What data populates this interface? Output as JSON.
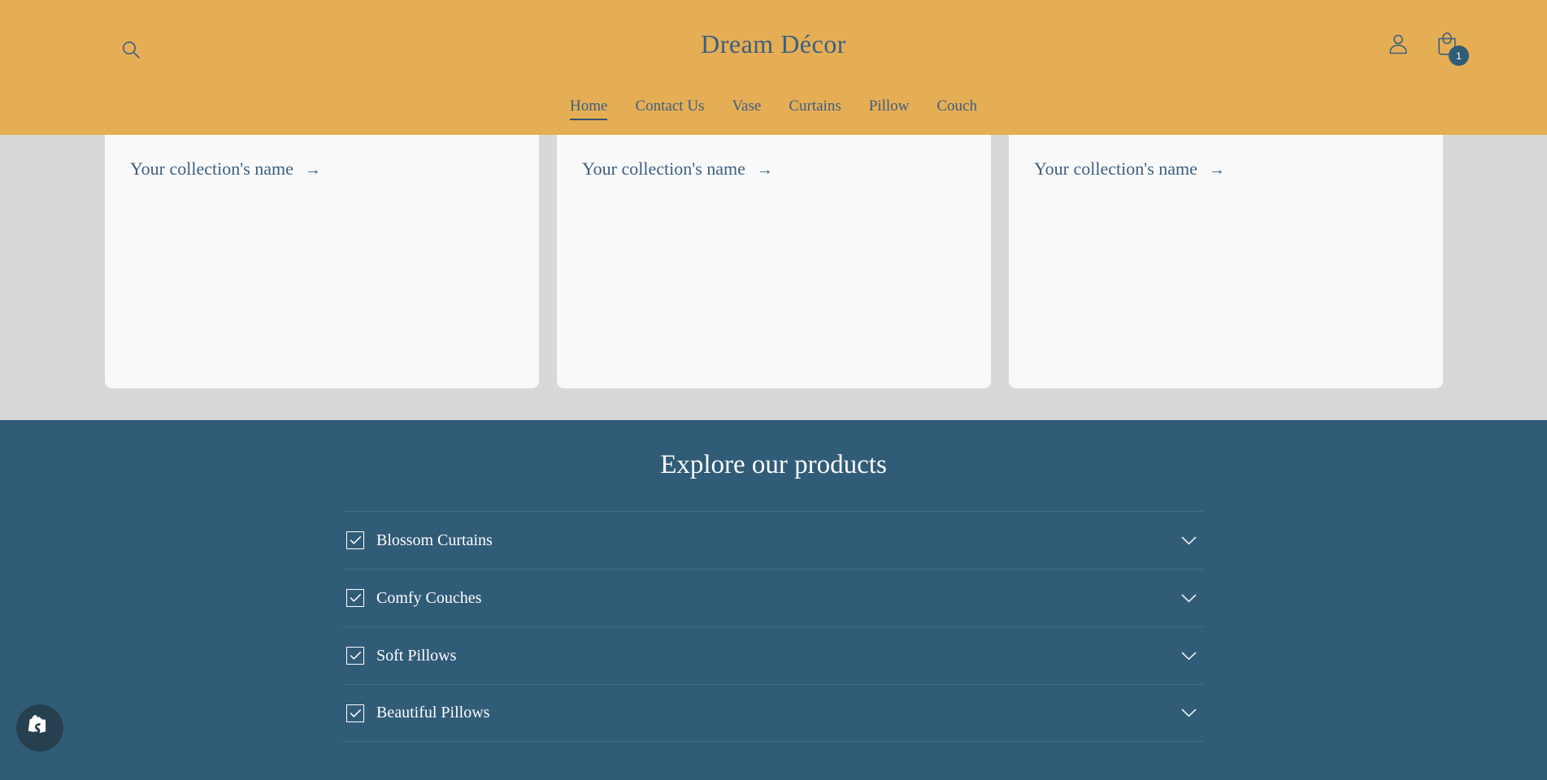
{
  "header": {
    "brand_title": "Dream Décor",
    "search_icon": "search-icon",
    "account_icon": "account-icon",
    "cart_icon": "cart-bag-icon",
    "cart_count": "1",
    "nav": [
      {
        "label": "Home",
        "active": true
      },
      {
        "label": "Contact Us",
        "active": false
      },
      {
        "label": "Vase",
        "active": false
      },
      {
        "label": "Curtains",
        "active": false
      },
      {
        "label": "Pillow",
        "active": false
      },
      {
        "label": "Couch",
        "active": false
      }
    ]
  },
  "collections": [
    {
      "title": "Your collection's name",
      "arrow": "→"
    },
    {
      "title": "Your collection's name",
      "arrow": "→"
    },
    {
      "title": "Your collection's name",
      "arrow": "→"
    }
  ],
  "explore": {
    "heading": "Explore our products",
    "items": [
      {
        "label": "Blossom Curtains",
        "checked": true,
        "chevron": "chevron-down-icon"
      },
      {
        "label": "Comfy Couches",
        "checked": true,
        "chevron": "chevron-down-icon"
      },
      {
        "label": "Soft Pillows",
        "checked": true,
        "chevron": "chevron-down-icon"
      },
      {
        "label": "Beautiful Pillows",
        "checked": true,
        "chevron": "chevron-down-icon"
      }
    ]
  },
  "fab": {
    "icon": "shopify-bag-icon"
  },
  "colors": {
    "header_bg": "#e5ad54",
    "accent_blue": "#315c78",
    "page_bg": "#d8d8d8",
    "card_bg": "#f9f9f9",
    "text_light": "#fdfdfd"
  }
}
